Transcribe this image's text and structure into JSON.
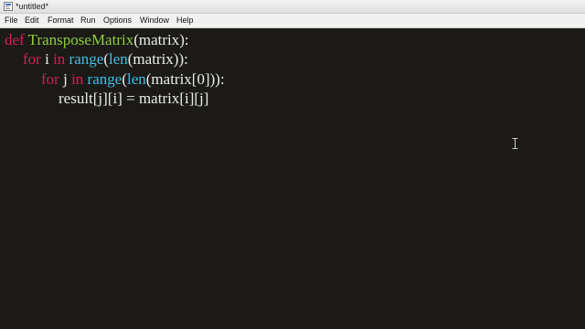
{
  "window": {
    "title": "*untitled*"
  },
  "menu": {
    "items": [
      "File",
      "Edit",
      "Format",
      "Run",
      "Options",
      "Window",
      "Help"
    ]
  },
  "editor": {
    "lines": [
      [
        {
          "t": "def",
          "c": "kw"
        },
        {
          "t": " ",
          "c": "txt"
        },
        {
          "t": "TransposeMatrix",
          "c": "fn"
        },
        {
          "t": "(matrix):",
          "c": "txt"
        }
      ],
      [
        {
          "t": "for",
          "c": "kw"
        },
        {
          "t": " i ",
          "c": "txt"
        },
        {
          "t": "in",
          "c": "kw"
        },
        {
          "t": " ",
          "c": "txt"
        },
        {
          "t": "range",
          "c": "bi"
        },
        {
          "t": "(",
          "c": "txt"
        },
        {
          "t": "len",
          "c": "bi"
        },
        {
          "t": "(matrix)):",
          "c": "txt"
        }
      ],
      [
        {
          "t": "for",
          "c": "kw"
        },
        {
          "t": " j ",
          "c": "txt"
        },
        {
          "t": "in",
          "c": "kw"
        },
        {
          "t": " ",
          "c": "txt"
        },
        {
          "t": "range",
          "c": "bi"
        },
        {
          "t": "(",
          "c": "txt"
        },
        {
          "t": "len",
          "c": "bi"
        },
        {
          "t": "(matrix[0])):",
          "c": "txt"
        }
      ],
      [
        {
          "t": "result[j][i] = matrix[i][j]",
          "c": "txt"
        }
      ]
    ]
  },
  "colors": {
    "editor_background": "#1b1a16",
    "keyword": "#d81e55",
    "function_name": "#8fcf3c",
    "builtin": "#3fc0e8",
    "default_text": "#ececec"
  },
  "icons": {
    "app": "idle-app-icon",
    "cursor": "text-ibeam-cursor"
  }
}
